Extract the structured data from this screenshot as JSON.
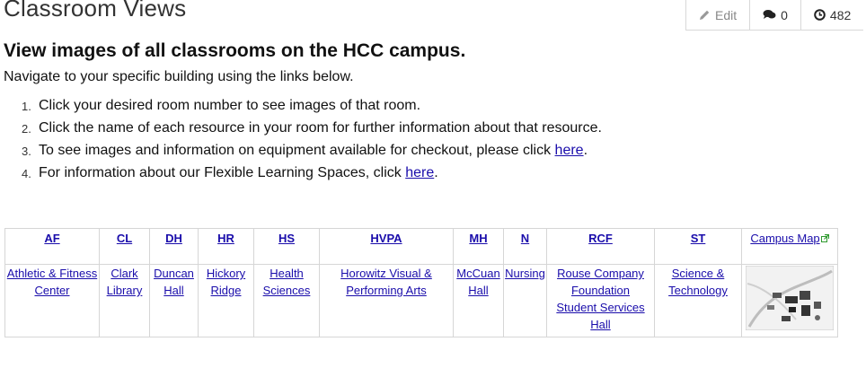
{
  "page": {
    "title": "Classroom Views"
  },
  "actions": {
    "edit_label": "Edit",
    "comments_count": "0",
    "views_count": "482"
  },
  "intro": {
    "heading": "View images of all classrooms on the HCC campus.",
    "navigate": "Navigate to your specific building using the links below."
  },
  "steps": [
    {
      "num": "1.",
      "text": "Click your desired room number to see images of that room."
    },
    {
      "num": "2.",
      "text": "Click the name of each resource in your room for further information about that resource."
    },
    {
      "num": "3.",
      "text": "To see images and information on equipment available for checkout, please click ",
      "link": "here",
      "after": "."
    },
    {
      "num": "4.",
      "text": "For information about our Flexible Learning Spaces, click ",
      "link": "here",
      "after": "."
    }
  ],
  "buildings": [
    {
      "code": "AF",
      "name_lines": [
        "Athletic & Fitness",
        "Center"
      ]
    },
    {
      "code": "CL",
      "name_lines": [
        "Clark",
        "Library"
      ]
    },
    {
      "code": "DH",
      "name_lines": [
        "Duncan",
        "Hall"
      ]
    },
    {
      "code": "HR",
      "name_lines": [
        "Hickory",
        "Ridge"
      ]
    },
    {
      "code": "HS",
      "name_lines": [
        "Health",
        "Sciences"
      ]
    },
    {
      "code": "HVPA",
      "name_lines": [
        "Horowitz Visual &",
        "Performing Arts"
      ]
    },
    {
      "code": "MH",
      "name_lines": [
        "McCuan",
        "Hall"
      ]
    },
    {
      "code": "N",
      "name_lines": [
        "Nursing"
      ]
    },
    {
      "code": "RCF",
      "name_lines": [
        "Rouse Company",
        "Foundation ",
        "Student Services",
        "Hall"
      ]
    },
    {
      "code": "ST",
      "name_lines": [
        "Science &",
        "Technology"
      ]
    }
  ],
  "campus_map": {
    "label": "Campus Map",
    "icon": "external-link-icon",
    "thumbnail_icon": "campus-map-thumbnail"
  },
  "colors": {
    "link": "#1a0dab",
    "border": "#d6d6d6",
    "external_link_icon": "#2e9a2e"
  }
}
